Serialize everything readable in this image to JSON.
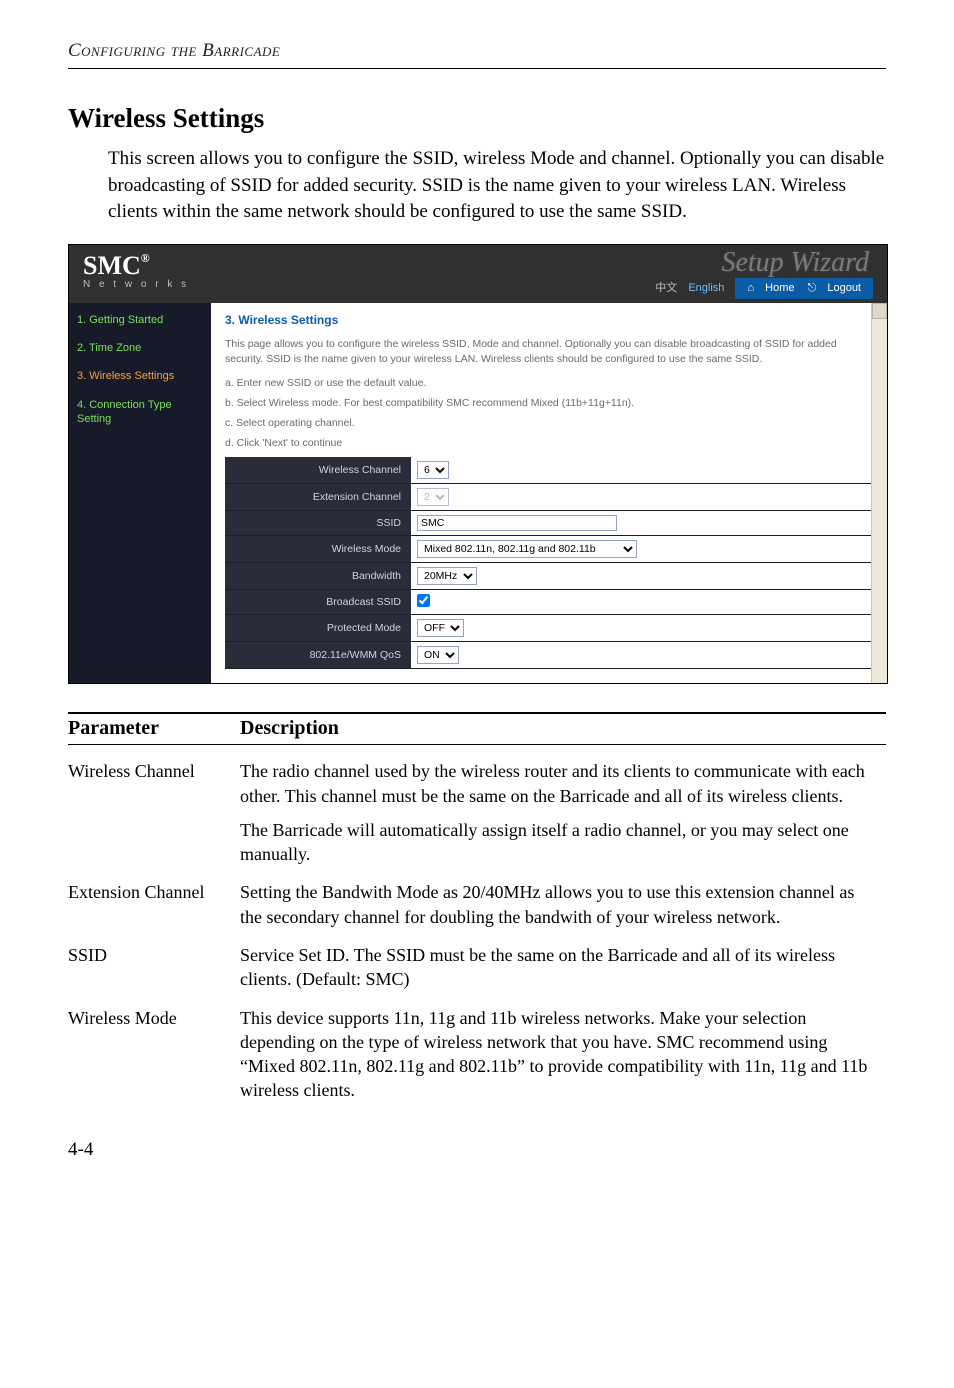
{
  "page_header": "Configuring the Barricade",
  "section_heading": "Wireless Settings",
  "body_text": "This screen allows you to configure the SSID, wireless Mode and channel. Optionally you can disable broadcasting of SSID for added security. SSID is the name given to your wireless LAN. Wireless clients within the same network should be configured to use the same SSID.",
  "shot": {
    "logo": "SMC",
    "logo_reg": "®",
    "logo_sub": "N e t w o r k s",
    "setup_title": "Setup Wizard",
    "lang_zh": "中文",
    "lang_en": "English",
    "home_label": "Home",
    "logout_label": "Logout",
    "sidebar": [
      {
        "name": "getting-started",
        "label": "1. Getting Started",
        "cls": "sb-green"
      },
      {
        "name": "time-zone",
        "label": "2. Time Zone",
        "cls": "sb-green"
      },
      {
        "name": "wireless-settings",
        "label": "3. Wireless Settings",
        "cls": "sb-orange"
      },
      {
        "name": "connection-type",
        "label": "4. Connection Type Setting",
        "cls": "sb-green"
      }
    ],
    "panel_title": "3. Wireless Settings",
    "intro": "This page allows you to configure the wireless SSID, Mode and channel. Optionally you can disable broadcasting of SSID for added security. SSID is the name given to your wireless LAN. Wireless clients should be configured to use the same SSID.",
    "steps": {
      "a": "a. Enter new SSID or use the default value.",
      "b": "b. Select Wireless mode. For best compatibility SMC recommend Mixed (11b+11g+11n).",
      "c": "c. Select operating channel.",
      "d": "d. Click 'Next' to continue"
    },
    "form": {
      "wireless_channel": {
        "label": "Wireless Channel",
        "value": "6"
      },
      "extension_channel": {
        "label": "Extension Channel",
        "value": "2"
      },
      "ssid": {
        "label": "SSID",
        "value": "SMC"
      },
      "wireless_mode": {
        "label": "Wireless Mode",
        "value": "Mixed 802.11n, 802.11g and 802.11b"
      },
      "bandwidth": {
        "label": "Bandwidth",
        "value": "20MHz"
      },
      "broadcast_ssid": {
        "label": "Broadcast SSID",
        "checked": true
      },
      "protected_mode": {
        "label": "Protected Mode",
        "value": "OFF"
      },
      "wmm_qos": {
        "label": "802.11e/WMM QoS",
        "value": "ON"
      }
    }
  },
  "table": {
    "h_param": "Parameter",
    "h_desc": "Description",
    "rows": [
      {
        "name": "Wireless Channel",
        "desc1": "The radio channel used by the wireless router and its clients to communicate with each other. This channel must be the same on the Barricade and all of its wireless clients.",
        "desc2": "The Barricade will automatically assign itself a radio channel, or you may select one manually."
      },
      {
        "name": "Extension Channel",
        "desc1": "Setting the Bandwith Mode as 20/40MHz allows you to use this extension channel as the secondary channel for doubling the bandwith of your wireless network."
      },
      {
        "name": "SSID",
        "desc1": "Service Set ID. The SSID must be the same on the Barricade and all of its wireless clients. (Default: SMC)"
      },
      {
        "name": "Wireless Mode",
        "desc1": "This device supports 11n, 11g and 11b wireless networks. Make your selection depending on the type of wireless network that you have. SMC recommend using “Mixed 802.11n, 802.11g and 802.11b” to provide compatibility with 11n, 11g and 11b wireless clients."
      }
    ]
  },
  "page_num": "4-4"
}
